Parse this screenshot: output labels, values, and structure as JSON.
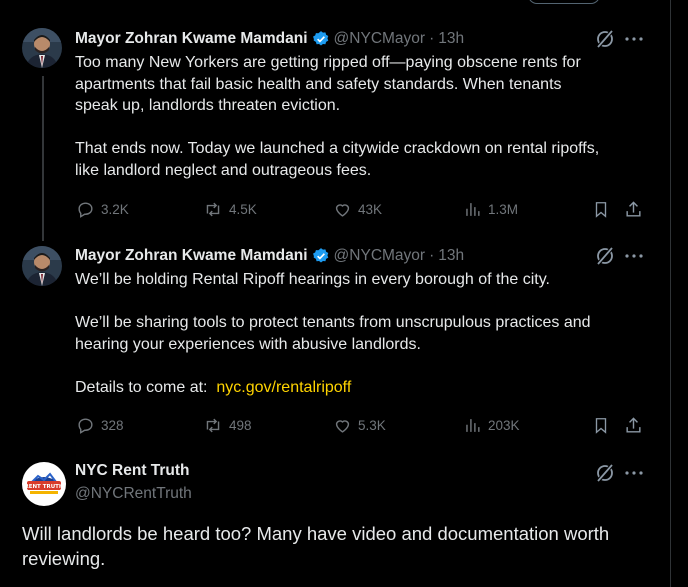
{
  "tweets": [
    {
      "name": "Mayor Zohran Kwame Mamdani",
      "handle": "@NYCMayor",
      "separator": "·",
      "time": "13h",
      "lines": [
        "Too many New Yorkers are getting ripped off—paying obscene rents for",
        "apartments that fail basic health and safety standards. When tenants",
        "speak up, landlords threaten eviction.",
        "",
        "That ends now. Today we launched a citywide crackdown on rental ripoffs,",
        "like landlord neglect and outrageous fees."
      ],
      "stats": {
        "replies": "3.2K",
        "reposts": "4.5K",
        "likes": "43K",
        "views": "1.3M"
      }
    },
    {
      "name": "Mayor Zohran Kwame Mamdani",
      "handle": "@NYCMayor",
      "separator": "·",
      "time": "13h",
      "line1": "We’ll be holding Rental Ripoff hearings in every borough of the city.",
      "line2": "We’ll be sharing tools to protect tenants from unscrupulous  practices and",
      "line3": "hearing your experiences with abusive landlords.",
      "details_label": "Details to come at:",
      "link": "nyc.gov/rentalripoff",
      "stats": {
        "replies": "328",
        "reposts": "498",
        "likes": "5.3K",
        "views": "203K"
      }
    }
  ],
  "reply": {
    "name": "NYC Rent Truth",
    "handle": "@NYCRentTruth",
    "avatar_text": "RENT TRUTH",
    "text": "Will landlords be heard too? Many have video and documentation worth reviewing."
  },
  "colors": {
    "background": "#000000",
    "text": "#e7e9ea",
    "muted": "#71767b",
    "verified": "#1d9bf0",
    "link": "#ffd400",
    "thread_line": "#333639"
  },
  "icons": [
    "verified-icon",
    "grok-icon",
    "more-icon",
    "reply-icon",
    "repost-icon",
    "like-icon",
    "views-icon",
    "bookmark-icon",
    "share-icon"
  ]
}
